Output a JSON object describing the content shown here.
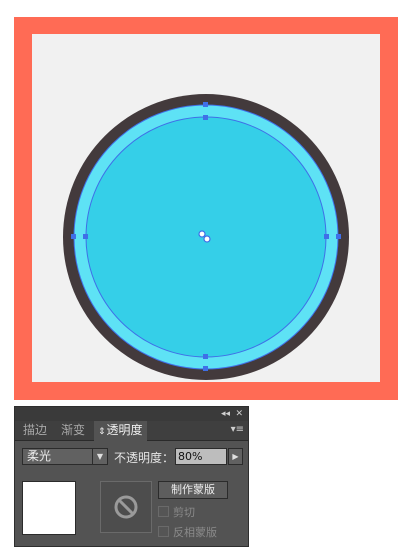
{
  "colors": {
    "artboard": "#ff6b55",
    "canvas": "#f1f1f1",
    "outer_ring": "#433a3c",
    "light_ring": "#5ee2f5",
    "fill": "#35cfe8",
    "selection": "#3f6fe8"
  },
  "panel": {
    "collapse_icon": "◂◂",
    "close_icon": "✕",
    "menu_icon": "▾≡",
    "tabs": [
      {
        "label": "描边"
      },
      {
        "label": "渐变"
      },
      {
        "label": "透明度"
      }
    ],
    "tab_arrows": "⇕",
    "blend_mode": "柔光",
    "blend_arrow": "▼",
    "opacity_label": "不透明度：",
    "opacity_value": "80%",
    "opacity_arrow": "▶",
    "make_mask_label": "制作蒙版",
    "clip_label": "剪切",
    "invert_label": "反相蒙版"
  }
}
